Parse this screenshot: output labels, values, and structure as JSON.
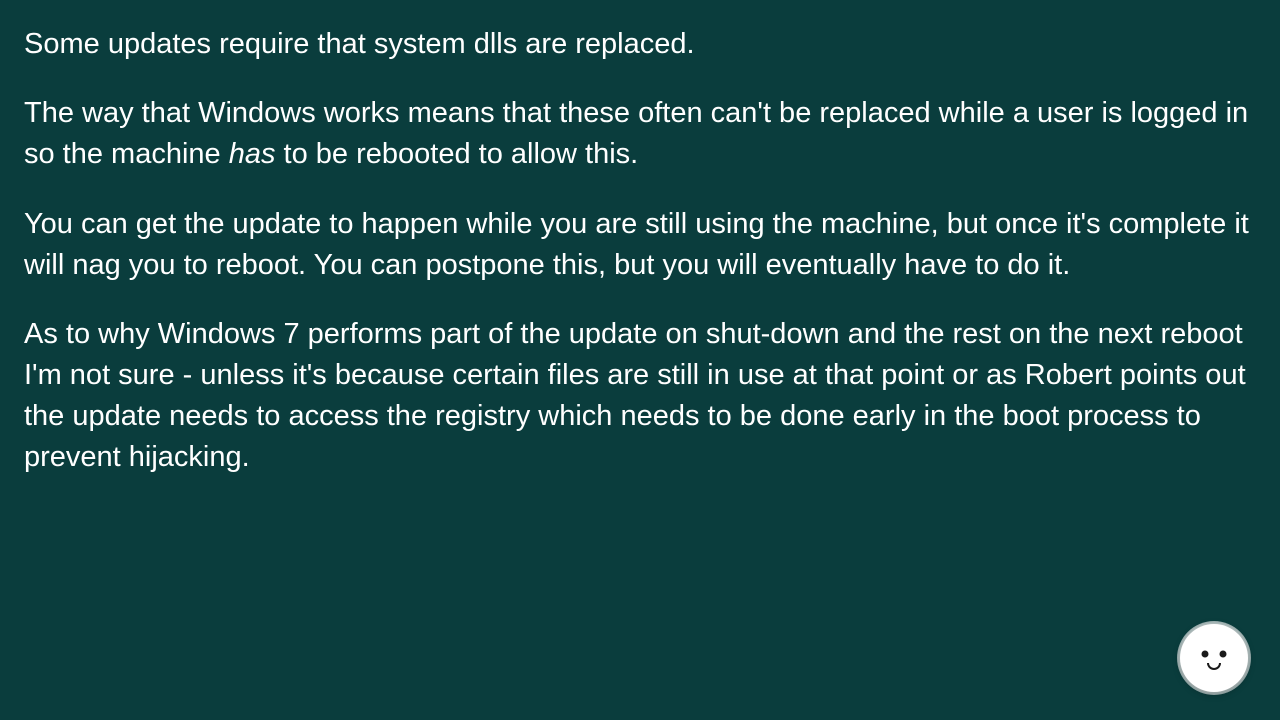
{
  "paragraphs": {
    "p1": "Some updates require that system dlls are replaced.",
    "p2_a": "The way that Windows works means that these often can't be replaced while a user is logged in so the machine ",
    "p2_em": "has",
    "p2_b": " to be rebooted to allow this.",
    "p3": "You can get the update to happen while you are still using the machine, but once it's complete it will nag you to reboot. You can postpone this, but you will eventually have to do it.",
    "p4": "As to why Windows 7 performs part of the update on shut-down and the rest on the next reboot I'm not sure - unless it's because certain files are still in use at that point or as Robert points out the update needs to access the registry which needs to be done early in the boot process to prevent hijacking."
  }
}
